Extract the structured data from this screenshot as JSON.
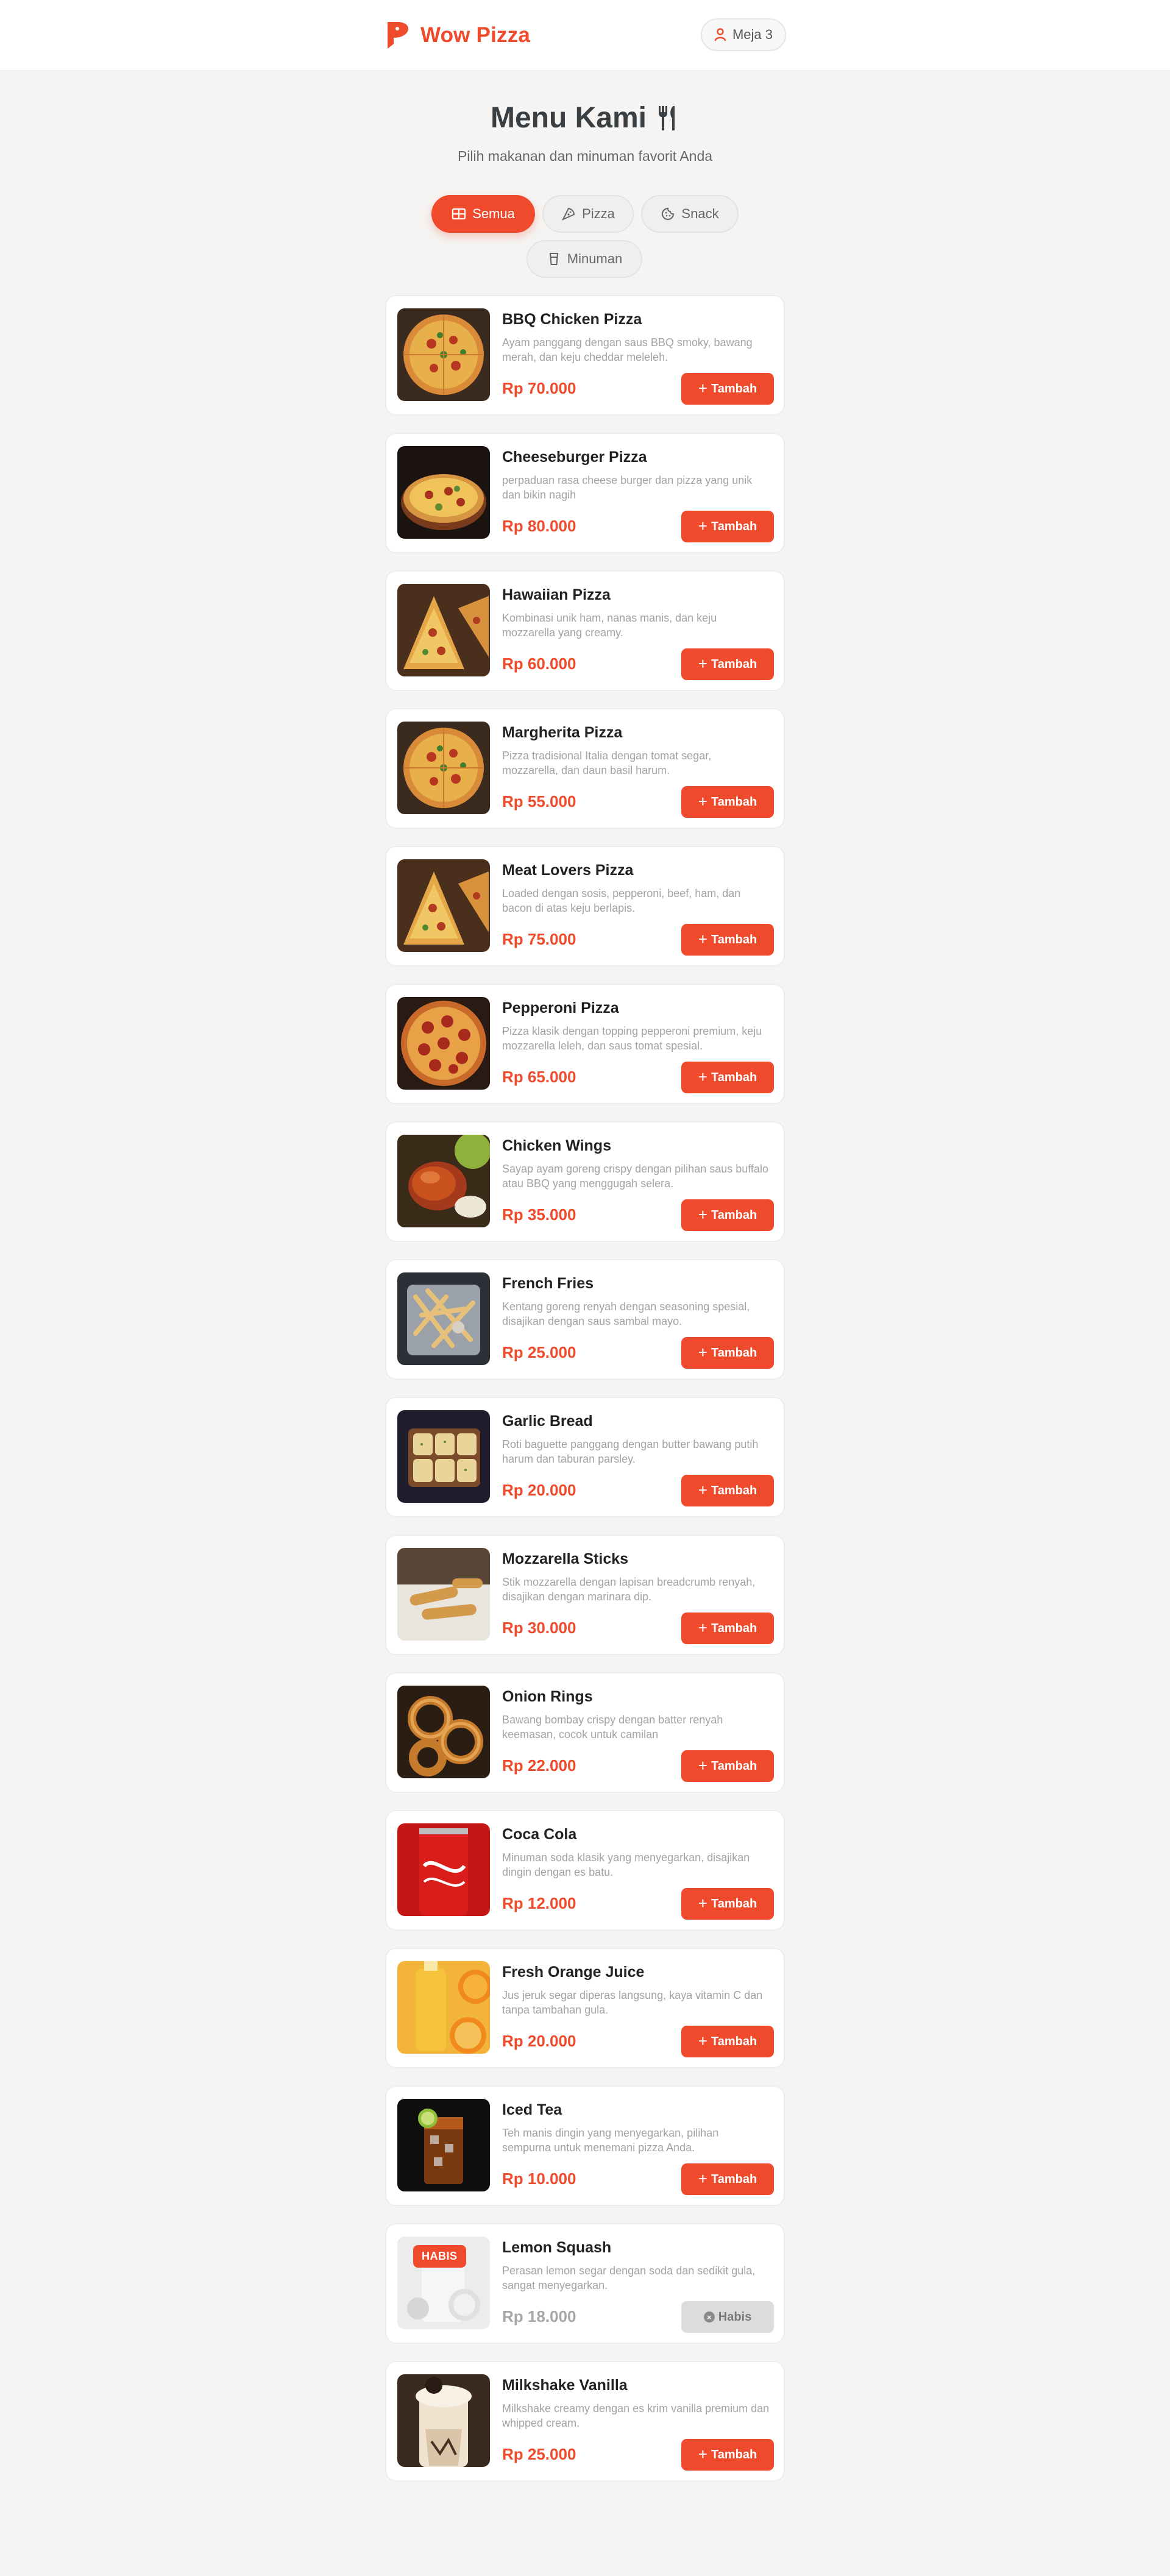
{
  "header": {
    "brand": "Wow Pizza",
    "table": "Meja 3"
  },
  "hero": {
    "title": "Menu Kami",
    "subtitle": "Pilih makanan dan minuman favorit Anda"
  },
  "tabs": [
    {
      "label": "Semua",
      "icon": "grid-icon",
      "active": true
    },
    {
      "label": "Pizza",
      "icon": "pizza-slice-icon",
      "active": false
    },
    {
      "label": "Snack",
      "icon": "cookie-icon",
      "active": false
    },
    {
      "label": "Minuman",
      "icon": "cup-icon",
      "active": false
    }
  ],
  "add_label": "Tambah",
  "soldout_label": "Habis",
  "soldout_badge": "HABIS",
  "items": [
    {
      "name": "BBQ Chicken Pizza",
      "desc": "Ayam panggang dengan saus BBQ smoky, bawang merah, dan keju cheddar meleleh.",
      "price": "Rp 70.000",
      "available": true,
      "photo": "pizza"
    },
    {
      "name": "Cheeseburger Pizza",
      "desc": "perpaduan rasa cheese burger dan pizza yang unik dan bikin nagih",
      "price": "Rp 80.000",
      "available": true,
      "photo": "pizza-dark"
    },
    {
      "name": "Hawaiian Pizza",
      "desc": "Kombinasi unik ham, nanas manis, dan keju mozzarella yang creamy.",
      "price": "Rp 60.000",
      "available": true,
      "photo": "slices"
    },
    {
      "name": "Margherita Pizza",
      "desc": "Pizza tradisional Italia dengan tomat segar, mozzarella, dan daun basil harum.",
      "price": "Rp 55.000",
      "available": true,
      "photo": "pizza"
    },
    {
      "name": "Meat Lovers Pizza",
      "desc": "Loaded dengan sosis, pepperoni, beef, ham, dan bacon di atas keju berlapis.",
      "price": "Rp 75.000",
      "available": true,
      "photo": "slices"
    },
    {
      "name": "Pepperoni Pizza",
      "desc": "Pizza klasik dengan topping pepperoni premium, keju mozzarella leleh, dan saus tomat spesial.",
      "price": "Rp 65.000",
      "available": true,
      "photo": "pepperoni"
    },
    {
      "name": "Chicken Wings",
      "desc": "Sayap ayam goreng crispy dengan pilihan saus buffalo atau BBQ yang menggugah selera.",
      "price": "Rp 35.000",
      "available": true,
      "photo": "wings"
    },
    {
      "name": "French Fries",
      "desc": "Kentang goreng renyah dengan seasoning spesial, disajikan dengan saus sambal mayo.",
      "price": "Rp 25.000",
      "available": true,
      "photo": "fries"
    },
    {
      "name": "Garlic Bread",
      "desc": "Roti baguette panggang dengan butter bawang putih harum dan taburan parsley.",
      "price": "Rp 20.000",
      "available": true,
      "photo": "bread"
    },
    {
      "name": "Mozzarella Sticks",
      "desc": "Stik mozzarella dengan lapisan breadcrumb renyah, disajikan dengan marinara dip.",
      "price": "Rp 30.000",
      "available": true,
      "photo": "sticks"
    },
    {
      "name": "Onion Rings",
      "desc": "Bawang bombay crispy dengan batter renyah keemasan, cocok untuk camilan",
      "price": "Rp 22.000",
      "available": true,
      "photo": "rings"
    },
    {
      "name": "Coca Cola",
      "desc": "Minuman soda klasik yang menyegarkan, disajikan dingin dengan es batu.",
      "price": "Rp 12.000",
      "available": true,
      "photo": "cola"
    },
    {
      "name": "Fresh Orange Juice",
      "desc": "Jus jeruk segar diperas langsung, kaya vitamin C dan tanpa tambahan gula.",
      "price": "Rp 20.000",
      "available": true,
      "photo": "orange"
    },
    {
      "name": "Iced Tea",
      "desc": "Teh manis dingin yang menyegarkan, pilihan sempurna untuk menemani pizza Anda.",
      "price": "Rp 10.000",
      "available": true,
      "photo": "tea"
    },
    {
      "name": "Lemon Squash",
      "desc": "Perasan lemon segar dengan soda dan sedikit gula, sangat menyegarkan.",
      "price": "Rp 18.000",
      "available": false,
      "photo": "lemon"
    },
    {
      "name": "Milkshake Vanilla",
      "desc": "Milkshake creamy dengan es krim vanilla premium dan whipped cream.",
      "price": "Rp 25.000",
      "available": true,
      "photo": "shake"
    }
  ],
  "colors": {
    "accent": "#ef4a2b",
    "muted_text": "#a3a3a3",
    "disabled": "#dcdcdc"
  }
}
